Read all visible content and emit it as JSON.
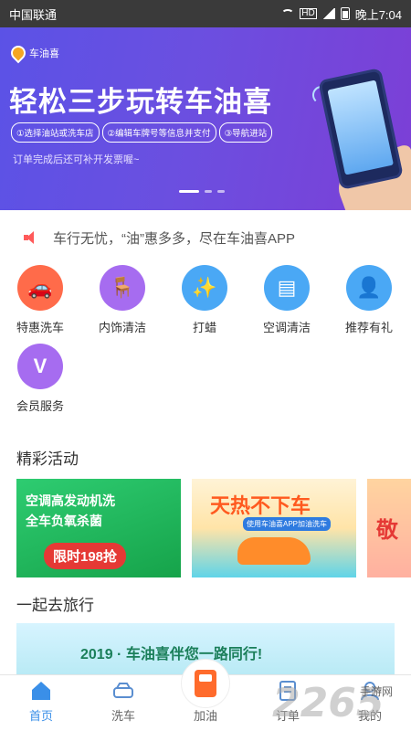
{
  "status_bar": {
    "carrier": "中国联通",
    "network": "HD",
    "time": "晚上7:04"
  },
  "banner": {
    "logo_text": "车油喜",
    "headline": "轻松三步玩转车油喜",
    "steps": [
      "①选择油站或洗车店",
      "②编辑车牌号等信息并支付",
      "③导航进站"
    ],
    "subtitle": "订单完成后还可补开发票喔~",
    "page_count": 3,
    "active_index": 0
  },
  "notice": {
    "text": "车行无忧，“油”惠多多，尽在车油喜APP"
  },
  "services": [
    {
      "label": "特惠洗车",
      "icon": "car-wash-icon",
      "color": "#ff6b4a"
    },
    {
      "label": "内饰清洁",
      "icon": "interior-clean-icon",
      "color": "#a66cf0"
    },
    {
      "label": "打蜡",
      "icon": "wax-icon",
      "color": "#4aa8f5"
    },
    {
      "label": "空调清洁",
      "icon": "air-conditioner-icon",
      "color": "#4aa8f5"
    },
    {
      "label": "推荐有礼",
      "icon": "referral-icon",
      "color": "#4aa8f5"
    },
    {
      "label": "会员服务",
      "icon": "vip-icon",
      "color": "#a66cf0"
    }
  ],
  "sections": {
    "activities_title": "精彩活动",
    "travel_title": "一起去旅行"
  },
  "activities": [
    {
      "line1": "空调高发动机洗",
      "line2": "全车负氧杀菌",
      "price": "限时198抢"
    },
    {
      "line1": "天热不下车",
      "line2": "使用车油喜APP加油洗车"
    },
    {
      "line1": "敬"
    }
  ],
  "travel": {
    "text": "2019 · 车油喜伴您一路同行!"
  },
  "bottom_nav": [
    {
      "label": "首页",
      "icon": "home-icon",
      "active": true
    },
    {
      "label": "洗车",
      "icon": "car-wash-icon",
      "active": false
    },
    {
      "label": "加油",
      "icon": "fuel-pump-icon",
      "active": false
    },
    {
      "label": "订单",
      "icon": "order-icon",
      "active": false
    },
    {
      "label": "我的",
      "icon": "profile-icon",
      "active": false
    }
  ],
  "watermark": {
    "number": "2265",
    "site": "手游网"
  },
  "colors": {
    "accent": "#3a8fe8",
    "banner_start": "#5b52e6",
    "banner_end": "#7c3fd6"
  }
}
